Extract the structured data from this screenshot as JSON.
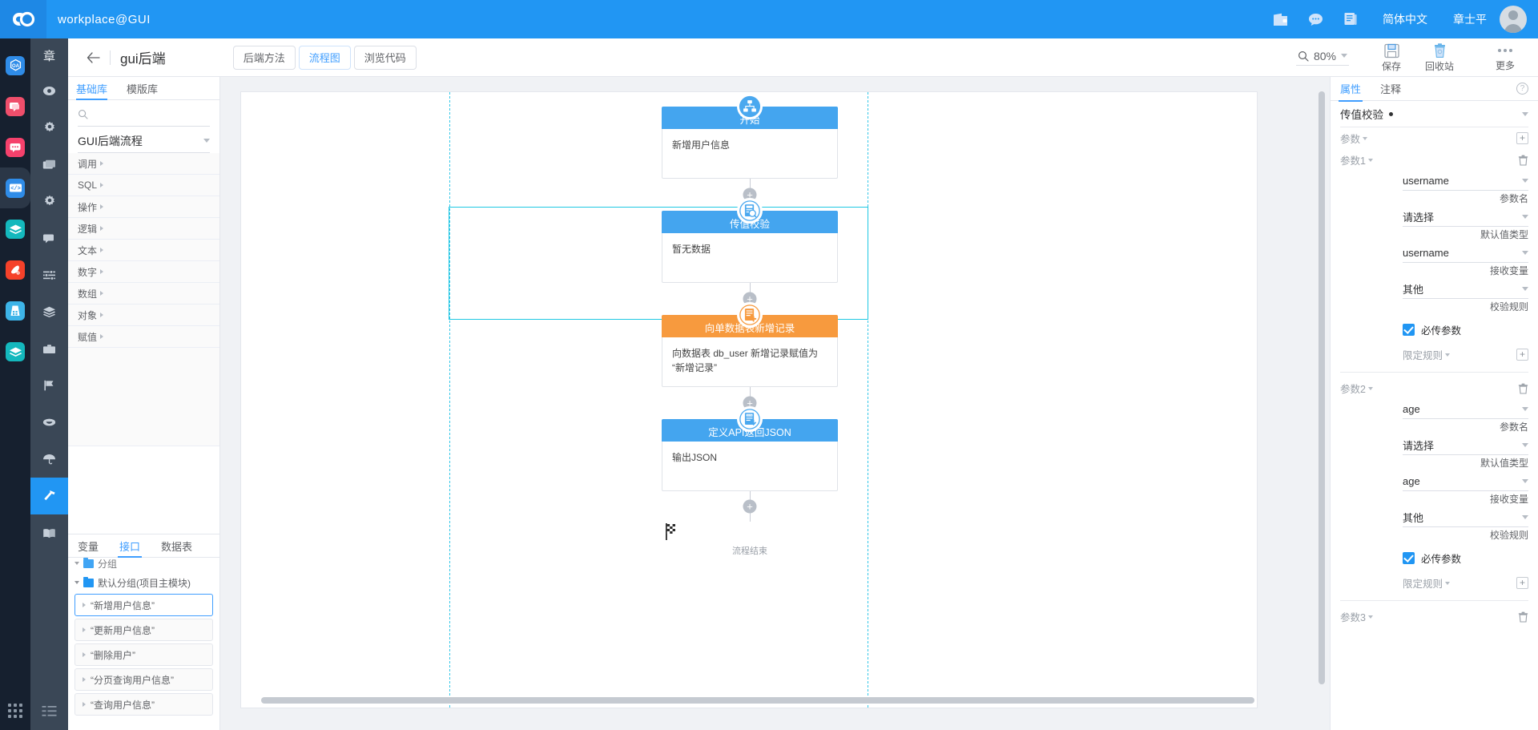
{
  "topbar": {
    "title": "workplace@GUI",
    "logo_icon": "cloud-logo-icon",
    "icons": [
      {
        "name": "wallet-icon"
      },
      {
        "name": "chat-bubble-icon"
      },
      {
        "name": "document-icon"
      }
    ],
    "language": "简体中文",
    "user_name": "章士平"
  },
  "rail": {
    "items": [
      {
        "name": "oa-app-icon",
        "glyph": "OA",
        "color": "#2f8ce8",
        "active": false
      },
      {
        "name": "message-app-icon",
        "glyph": "",
        "color": "#ef4e6b",
        "active": false
      },
      {
        "name": "chat-app-icon",
        "glyph": "",
        "color": "#f5416c",
        "active": false
      },
      {
        "name": "code-app-icon",
        "glyph": "",
        "color": "#2f8ce8",
        "active": true
      },
      {
        "name": "layers-app-icon",
        "glyph": "",
        "color": "#14b8bd",
        "active": false
      },
      {
        "name": "paint-app-icon",
        "glyph": "",
        "color": "#f5412a",
        "active": false
      },
      {
        "name": "grid-app-icon",
        "glyph": "",
        "color": "#3db4e8",
        "active": false
      },
      {
        "name": "box-app-icon",
        "glyph": "",
        "color": "#14b8bd",
        "active": false
      }
    ],
    "bottom_icon": "apps-grid-icon"
  },
  "menubar": {
    "user_initial": "章",
    "items": [
      {
        "name": "eye-icon",
        "active": false
      },
      {
        "name": "gear-icon",
        "active": false
      },
      {
        "name": "window-icon",
        "active": false
      },
      {
        "name": "settings-icon",
        "active": false
      },
      {
        "name": "comment-icon",
        "active": false
      },
      {
        "name": "sliders-icon",
        "active": false
      },
      {
        "name": "stack-icon",
        "active": false
      },
      {
        "name": "briefcase-icon",
        "active": false
      },
      {
        "name": "flag-icon",
        "active": false
      },
      {
        "name": "smile-icon",
        "active": false
      },
      {
        "name": "umbrella-icon",
        "active": false
      },
      {
        "name": "hammer-icon",
        "active": true
      },
      {
        "name": "book-icon",
        "active": false
      }
    ],
    "bottom_icon": "list-toggle-icon"
  },
  "header": {
    "back_icon": "back-arrow-icon",
    "page_title": "gui后端",
    "tabs": [
      {
        "label": "后端方法",
        "active": false
      },
      {
        "label": "流程图",
        "active": true
      },
      {
        "label": "浏览代码",
        "active": false
      }
    ],
    "zoom": {
      "icon": "magnifier-icon",
      "value": "80%"
    },
    "actions": [
      {
        "name": "save-button",
        "icon": "floppy-icon",
        "label": "保存"
      },
      {
        "name": "recycle-bin-button",
        "icon": "trash-icon",
        "label": "回收站"
      }
    ],
    "more_label": "更多"
  },
  "library": {
    "tabs": [
      {
        "label": "基础库",
        "active": true
      },
      {
        "label": "模版库",
        "active": false
      }
    ],
    "search_placeholder": "",
    "group_title": "GUI后端流程",
    "rows": [
      {
        "label": "调用"
      },
      {
        "label": "SQL"
      },
      {
        "label": "操作"
      },
      {
        "label": "逻辑"
      },
      {
        "label": "文本"
      },
      {
        "label": "数字"
      },
      {
        "label": "数组"
      },
      {
        "label": "对象"
      },
      {
        "label": "赋值"
      }
    ]
  },
  "resources": {
    "tabs": [
      {
        "label": "变量",
        "active": false
      },
      {
        "label": "接口",
        "active": true
      },
      {
        "label": "数据表",
        "active": false
      }
    ],
    "tree": [
      {
        "label": "默认分组(项目主模块)",
        "type": "folder"
      }
    ],
    "apis": [
      {
        "label": "“新增用户信息”",
        "selected": true
      },
      {
        "label": "“更新用户信息”",
        "selected": false
      },
      {
        "label": "“删除用户”",
        "selected": false
      },
      {
        "label": "“分页查询用户信息”",
        "selected": false
      },
      {
        "label": "“查询用户信息”",
        "selected": false
      }
    ]
  },
  "canvas": {
    "selected_node_index": 1,
    "nodes": [
      {
        "title": "开始",
        "body": "新增用户信息",
        "color": "blue",
        "icon": "flow-start-icon",
        "selected": false
      },
      {
        "title": "传值校验",
        "body": "暂无数据",
        "color": "blue",
        "icon": "param-check-icon",
        "selected": true
      },
      {
        "title": "向单数据表新增记录",
        "body": "向数据表 db_user 新增记录赋值为 “新增记录”",
        "color": "orange",
        "icon": "db-insert-icon",
        "selected": false
      },
      {
        "title": "定义API返回JSON",
        "body": "输出JSON",
        "color": "blue",
        "icon": "json-output-icon",
        "selected": false
      }
    ],
    "end_label": "流程结束",
    "end_icon": "checkered-flag-icon",
    "add_button_label": "+",
    "float_toolbar": [
      {
        "name": "copy-icon"
      },
      {
        "name": "zoom-in-icon"
      },
      {
        "name": "zoom-out-icon"
      },
      {
        "name": "move-up-icon"
      },
      {
        "name": "move-down-icon"
      },
      {
        "name": "delete-icon"
      }
    ],
    "colors": {
      "blue": "#44a5ef",
      "orange": "#f79a3e",
      "selection": "#1fc8e3"
    }
  },
  "properties": {
    "tabs": [
      {
        "label": "属性",
        "active": true
      },
      {
        "label": "注释",
        "active": false
      }
    ],
    "help_icon": "help-circle-icon",
    "node_title": "传值校验",
    "section_label": "参数",
    "params": [
      {
        "label": "参数1",
        "name_value": "username",
        "name_caption": "参数名",
        "default_type_value": "请选择",
        "default_type_caption": "默认值类型",
        "receive_var_value": "username",
        "receive_var_caption": "接收变量",
        "rule_value": "其他",
        "rule_caption": "校验规则",
        "required_label": "必传参数",
        "required_checked": true,
        "limit_label": "限定规则"
      },
      {
        "label": "参数2",
        "name_value": "age",
        "name_caption": "参数名",
        "default_type_value": "请选择",
        "default_type_caption": "默认值类型",
        "receive_var_value": "age",
        "receive_var_caption": "接收变量",
        "rule_value": "其他",
        "rule_caption": "校验规则",
        "required_label": "必传参数",
        "required_checked": true,
        "limit_label": "限定规则"
      },
      {
        "label": "参数3",
        "name_value": "",
        "name_caption": "",
        "default_type_value": "",
        "default_type_caption": "",
        "receive_var_value": "",
        "receive_var_caption": "",
        "rule_value": "",
        "rule_caption": "",
        "required_label": "",
        "required_checked": false,
        "limit_label": ""
      }
    ]
  }
}
